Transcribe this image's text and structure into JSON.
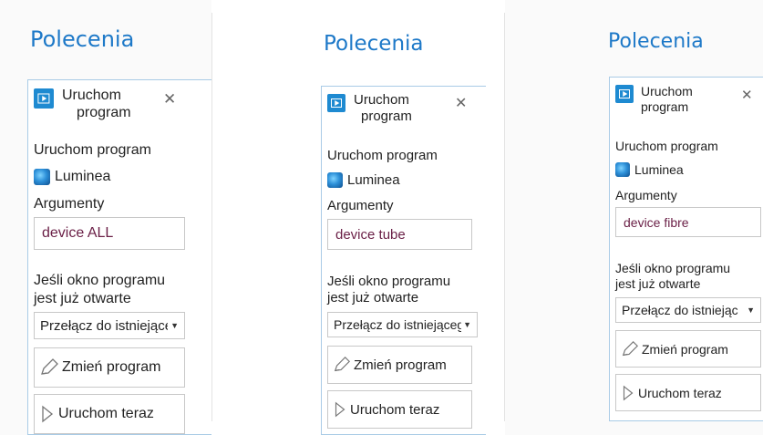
{
  "panels": [
    {
      "title": "Polecenia",
      "header_line1": "Uruchom",
      "header_line2": "program",
      "close_glyph": "✕",
      "section_run_label": "Uruchom program",
      "app_name": "Luminea",
      "args_label": "Argumenty",
      "args_value": "device ALL",
      "window_label_line1": "Jeśli okno programu",
      "window_label_line2": "jest już otwarte",
      "select_value": "Przełącz do istniejąceg",
      "change_program_label": "Zmień program",
      "run_now_label": "Uruchom teraz"
    },
    {
      "title": "Polecenia",
      "header_line1": "Uruchom",
      "header_line2": "program",
      "close_glyph": "✕",
      "section_run_label": "Uruchom program",
      "app_name": "Luminea",
      "args_label": "Argumenty",
      "args_value": "device tube",
      "window_label_line1": "Jeśli okno programu",
      "window_label_line2": "jest już otwarte",
      "select_value": "Przełącz do istniejąceg",
      "change_program_label": "Zmień program",
      "run_now_label": "Uruchom teraz"
    },
    {
      "title": "Polecenia",
      "header_line1": "Uruchom",
      "header_line2": "program",
      "close_glyph": "✕",
      "section_run_label": "Uruchom program",
      "app_name": "Luminea",
      "args_label": "Argumenty",
      "args_value": "device fibre",
      "window_label_line1": "Jeśli okno programu",
      "window_label_line2": "jest już otwarte",
      "select_value": "Przełącz do istniejąceg",
      "change_program_label": "Zmień program",
      "run_now_label": "Uruchom teraz"
    }
  ],
  "colors": {
    "title": "#1e79c8",
    "card_border": "#a9cbe6",
    "argument_text": "#6a1f46",
    "icon_blue": "#1e8ad1"
  },
  "icons": [
    "play-icon",
    "close-icon",
    "app-icon",
    "pencil-icon",
    "play-outline-icon",
    "dropdown-caret-icon"
  ]
}
